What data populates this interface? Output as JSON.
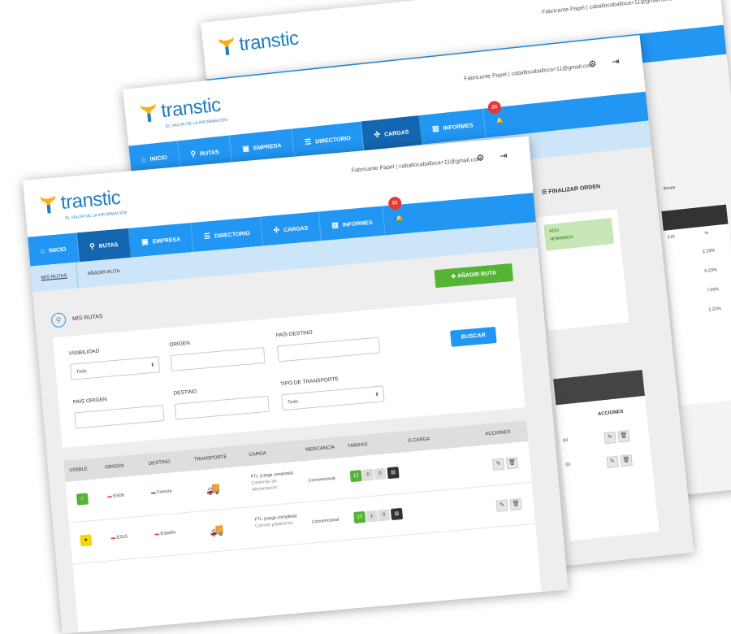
{
  "brand": {
    "name": "transtic",
    "tagline": "EL VALOR DE LA INFORMACIÓN"
  },
  "user": {
    "front": "Fabricante Papel | caballocaballoca+11@gmail.com",
    "back": "Fabricante Papel | caballocaballoca+11@gmail.com"
  },
  "nav": {
    "inicio": "INICIO",
    "rutas": "RUTAS",
    "empresa": "EMPRESA",
    "directorio": "DIRECTORIO",
    "cargas": "CARGAS",
    "informes": "INFORMES"
  },
  "badges": {
    "front": "21",
    "middle": "23"
  },
  "subnav": {
    "mis_rutas": "MIS RUTAS",
    "anadir_ruta": "AÑADIR RUTA"
  },
  "section": {
    "title": "MIS RUTAS",
    "add_button": "AÑADIR RUTA"
  },
  "filters": {
    "visibilidad_label": "VISIBILIDAD",
    "visibilidad_value": "Todo",
    "origen_label": "ORIGEN",
    "pais_destino_label": "PAÍS DESTINO",
    "buscar": "BUSCAR",
    "pais_origen_label": "PAÍS ORIGEN",
    "destino_label": "DESTINO",
    "tipo_label": "TIPO DE TRANSPORTE",
    "tipo_value": "Todo"
  },
  "table": {
    "headers": [
      "VISIBLE",
      "ORIGEN",
      "DESTINO",
      "TRANSPORTE",
      "CARGA",
      "MERCANCÍA",
      "TARIFAS",
      "O.CARGA",
      "ACCIONES"
    ],
    "rows": [
      {
        "origen": "ES08",
        "destino": "Francia",
        "carga": [
          "FTL (carga completa)",
          "Cisternas art.",
          "Alimentación"
        ],
        "mercancia": "Convencional",
        "tarifas": [
          "12",
          "0",
          "0"
        ]
      },
      {
        "origen": "ES15",
        "destino": "España",
        "carga": [
          "FTL (carga completa)",
          "Camión plataforma"
        ],
        "mercancia": "Convencional",
        "tarifas": [
          "10",
          "1",
          "0"
        ]
      }
    ]
  },
  "middle": {
    "finalizar": "FINALIZAR ORDEN",
    "estado1": "ADO",
    "estado2": "NFIRMADA",
    "acciones": "ACCIONES",
    "vals": [
      "00",
      "00"
    ]
  },
  "back": {
    "ordenes": "dones",
    "pct_header": [
      "CIA",
      "%"
    ],
    "pcts": [
      "2.15%",
      "6.23%",
      "7.55%",
      "2.22%"
    ]
  },
  "colors": {
    "nav": "#2196f3",
    "nav_active": "#1367b1",
    "subnav": "#cde5f8",
    "green": "#55b336",
    "badge": "#e53935"
  }
}
